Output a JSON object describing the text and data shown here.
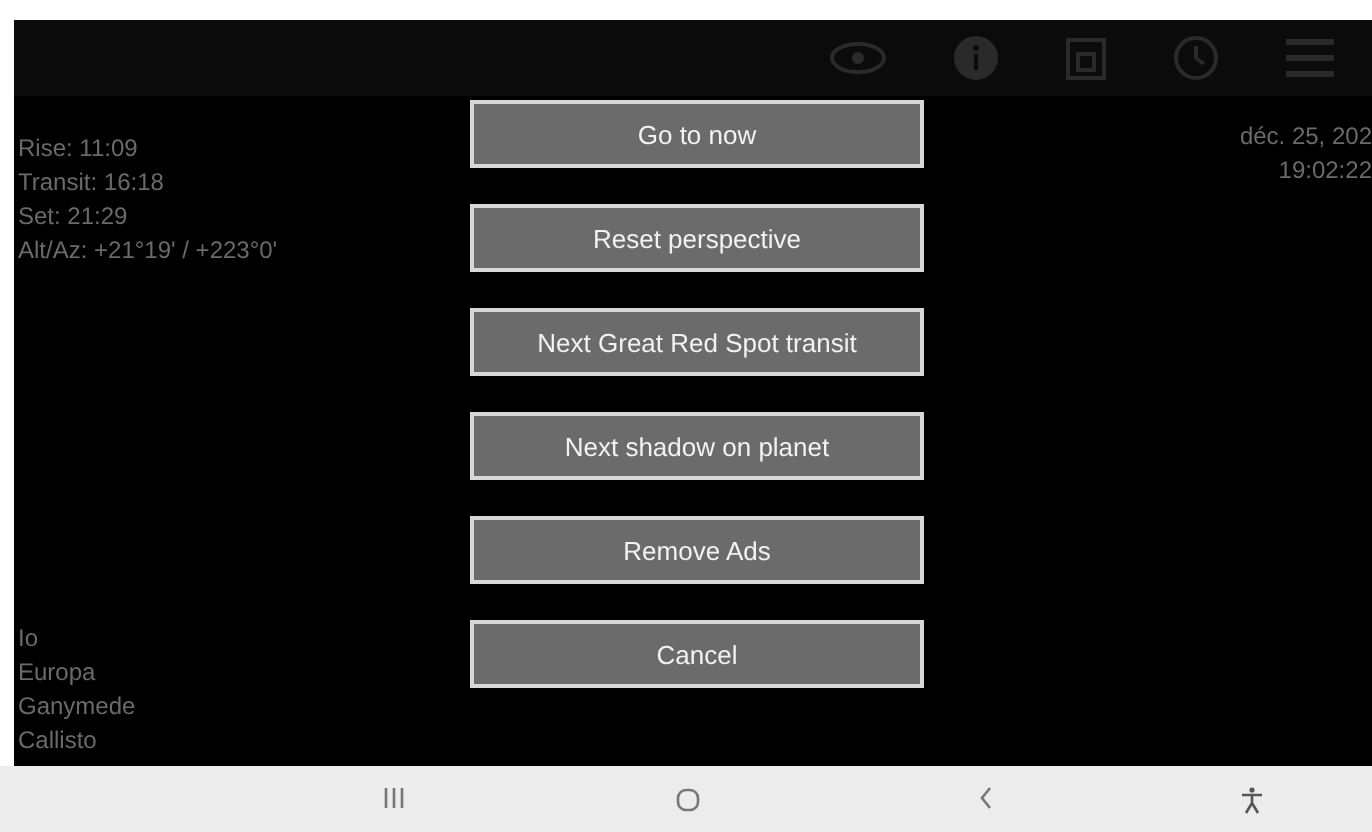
{
  "info": {
    "lines": [
      "Rise: 11:09",
      "Transit: 16:18",
      "Set: 21:29",
      "Alt/Az: +21°19' / +223°0'"
    ]
  },
  "datetime": {
    "date": "déc. 25, 202",
    "time": "19:02:22"
  },
  "moons": [
    "Io",
    "Europa",
    "Ganymede",
    "Callisto"
  ],
  "dialog": {
    "buttons": [
      "Go to now",
      "Reset perspective",
      "Next Great Red Spot transit",
      "Next shadow on planet",
      "Remove Ads",
      "Cancel"
    ]
  }
}
